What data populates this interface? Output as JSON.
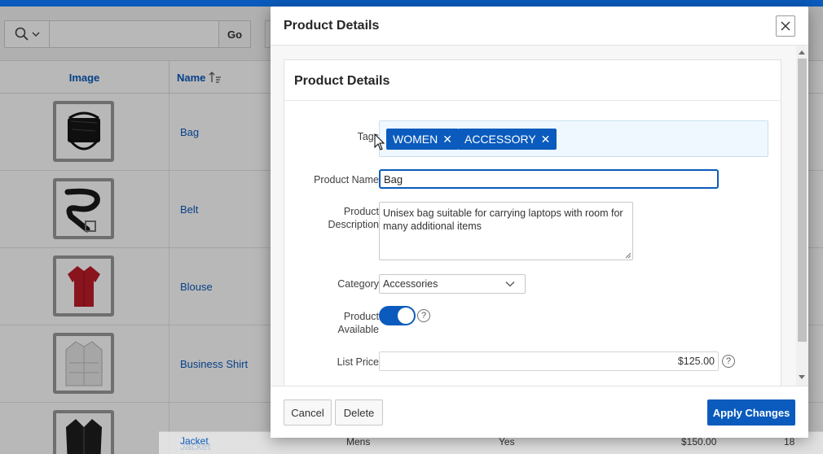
{
  "search": {
    "go_label": "Go",
    "value": ""
  },
  "report": {
    "columns": {
      "image": "Image",
      "name": "Name"
    },
    "rows": [
      {
        "name": "Bag"
      },
      {
        "name": "Belt"
      },
      {
        "name": "Blouse"
      },
      {
        "name": "Business Shirt"
      },
      {
        "name": "Jacket",
        "gender": "Mens",
        "available": "Yes",
        "price": "$150.00",
        "qty": "18"
      }
    ]
  },
  "dialog": {
    "title": "Product Details",
    "region_title": "Product Details",
    "labels": {
      "tags": "Tags",
      "product_name": "Product Name",
      "product_description_1": "Product",
      "product_description_2": "Description",
      "category": "Category",
      "product_available_1": "Product",
      "product_available_2": "Available",
      "list_price": "List Price"
    },
    "tags": [
      "WOMEN",
      "ACCESSORY"
    ],
    "product_name": "Bag",
    "product_description": "Unisex bag suitable for carrying laptops with room for many additional items",
    "category": "Accessories",
    "product_available": true,
    "list_price": "$125.00",
    "help_glyph": "?",
    "buttons": {
      "cancel": "Cancel",
      "delete": "Delete",
      "apply": "Apply Changes"
    }
  },
  "colors": {
    "brand": "#0a5bbd",
    "overlay": "rgba(0,0,0,0.28)"
  }
}
